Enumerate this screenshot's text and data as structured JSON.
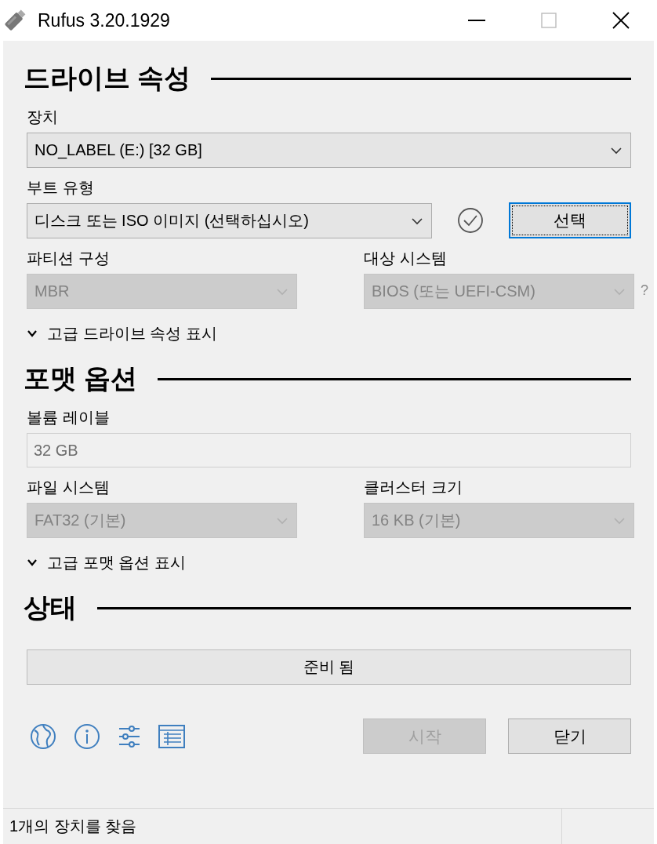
{
  "window": {
    "title": "Rufus 3.20.1929"
  },
  "sections": [
    {
      "heading": "드라이브 속성",
      "rows": [
        {
          "fields": [
            {
              "kind": "select",
              "label": "장치",
              "value": "NO_LABEL (E:) [32 GB]",
              "disabled": false
            }
          ]
        },
        {
          "fields": [
            {
              "kind": "select",
              "label": "부트 유형",
              "value": "디스크 또는 ISO 이미지 (선택하십시오)",
              "disabled": false
            },
            {
              "kind": "check"
            },
            {
              "kind": "button",
              "label": "선택",
              "focused": true,
              "disabled": false
            }
          ]
        },
        {
          "fields": [
            {
              "kind": "select",
              "label": "파티션 구성",
              "value": "MBR",
              "disabled": true
            },
            {
              "kind": "select",
              "label": "대상 시스템",
              "value": "BIOS (또는 UEFI-CSM)",
              "disabled": true,
              "help": "?"
            }
          ]
        }
      ],
      "toggle": {
        "label": "고급 드라이브 속성 표시",
        "expanded": false
      }
    },
    {
      "heading": "포맷 옵션",
      "rows": [
        {
          "fields": [
            {
              "kind": "input",
              "label": "볼륨 레이블",
              "value": "32 GB",
              "disabled": true
            }
          ]
        },
        {
          "fields": [
            {
              "kind": "select",
              "label": "파일 시스템",
              "value": "FAT32 (기본)",
              "disabled": true
            },
            {
              "kind": "select",
              "label": "클러스터 크기",
              "value": "16 KB (기본)",
              "disabled": true
            }
          ]
        }
      ],
      "toggle": {
        "label": "고급 포맷 옵션 표시",
        "expanded": false
      }
    },
    {
      "heading": "상태",
      "progress": {
        "text": "준비 됨",
        "level": 0
      }
    }
  ],
  "actions": [
    {
      "label": "시작",
      "disabled": true
    },
    {
      "label": "닫기",
      "disabled": false
    }
  ],
  "status_bar": {
    "text": "1개의 장치를 찾음"
  }
}
